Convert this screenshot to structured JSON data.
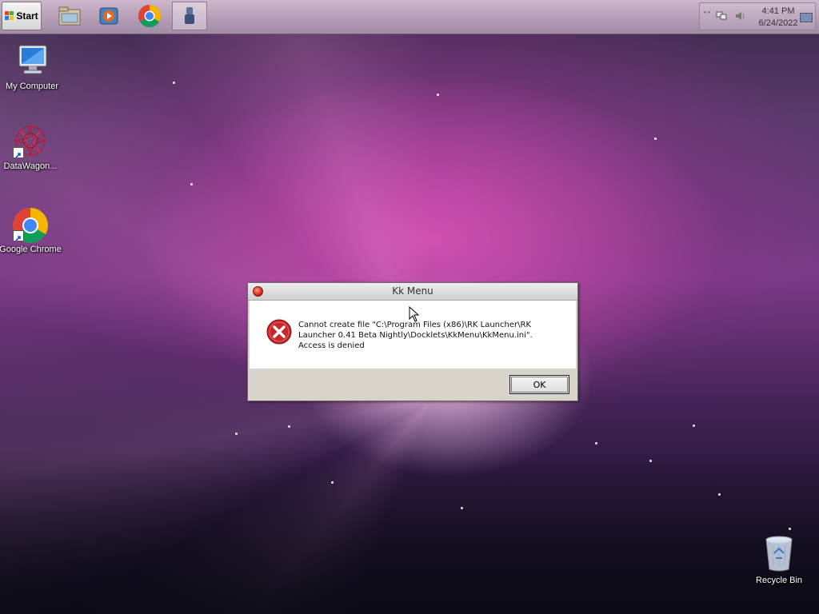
{
  "taskbar": {
    "start_label": "Start",
    "apps": [
      {
        "name": "file-explorer"
      },
      {
        "name": "media-player"
      },
      {
        "name": "google-chrome"
      },
      {
        "name": "rk-launcher"
      }
    ],
    "clock_time": "4:41 PM",
    "clock_date": "6/24/2022"
  },
  "desktop_icons": {
    "my_computer": "My Computer",
    "datawagon": "DataWagon...",
    "chrome": "Google Chrome",
    "recycle_bin": "Recycle Bin"
  },
  "dialog": {
    "title": "Kk Menu",
    "message": "Cannot create file \"C:\\Program Files (x86)\\RK Launcher\\RK Launcher 0.41 Beta Nightly\\Docklets\\KkMenu\\KkMenu.ini\". Access is denied",
    "ok_label": "OK"
  },
  "colors": {
    "taskbar": "#b29ab4",
    "error_red": "#c8262a",
    "wallpaper_pink": "#d65fc0"
  }
}
